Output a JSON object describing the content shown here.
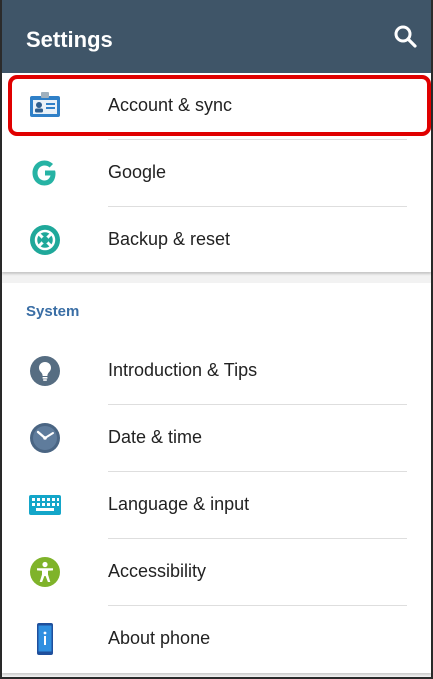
{
  "app_bar": {
    "title": "Settings",
    "search_icon": "search-icon"
  },
  "top_items": [
    {
      "label": "Account & sync",
      "icon": "account-sync-icon",
      "highlighted": true
    },
    {
      "label": "Google",
      "icon": "google-icon"
    },
    {
      "label": "Backup & reset",
      "icon": "backup-reset-icon"
    }
  ],
  "system_section": {
    "header": "System",
    "items": [
      {
        "label": "Introduction & Tips",
        "icon": "lightbulb-icon"
      },
      {
        "label": "Date & time",
        "icon": "clock-icon"
      },
      {
        "label": "Language & input",
        "icon": "keyboard-icon"
      },
      {
        "label": "Accessibility",
        "icon": "accessibility-icon"
      },
      {
        "label": "About phone",
        "icon": "phone-info-icon"
      }
    ]
  },
  "colors": {
    "app_bar": "#3f5568",
    "highlight": "#e00000",
    "section_header": "#3a6ea5",
    "google_teal": "#26b3a4"
  }
}
